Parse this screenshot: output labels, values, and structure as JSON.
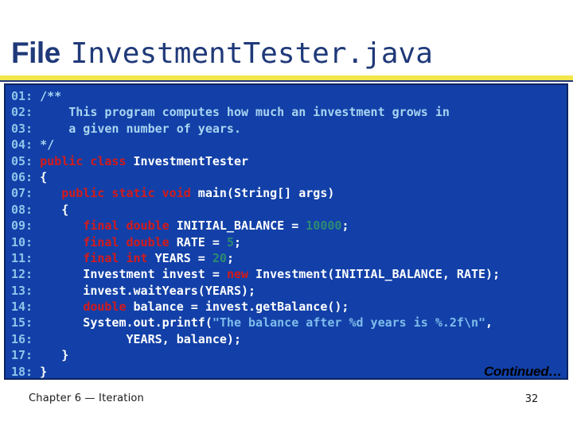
{
  "slide": {
    "title_label": "File",
    "title_filename": "InvestmentTester.java",
    "continued_label": "Continued…",
    "footer_chapter": "Chapter 6 — Iteration",
    "footer_page": "32"
  },
  "colors": {
    "title_navy": "#1F3979",
    "rule_yellow": "#F2E64B",
    "code_background": "#1240A8",
    "code_border": "#0B2461",
    "line_number": "#8FC4EA",
    "comment": "#A8D4F0",
    "keyword": "#D41A1A",
    "identifier": "#FFFFFF",
    "number_literal": "#2E8B74",
    "string_literal": "#7FBDEC"
  },
  "code": {
    "language": "java",
    "lines": [
      {
        "number": "01:",
        "tokens": [
          {
            "t": " ",
            "c": "id"
          },
          {
            "t": "/**",
            "c": "cmt"
          }
        ]
      },
      {
        "number": "02:",
        "tokens": [
          {
            "t": "     This program computes how much an investment grows in",
            "c": "cmt"
          }
        ]
      },
      {
        "number": "03:",
        "tokens": [
          {
            "t": "     a given number of years.",
            "c": "cmt"
          }
        ]
      },
      {
        "number": "04:",
        "tokens": [
          {
            "t": " ",
            "c": "id"
          },
          {
            "t": "*/",
            "c": "cmt"
          }
        ]
      },
      {
        "number": "05:",
        "tokens": [
          {
            "t": " ",
            "c": "id"
          },
          {
            "t": "public class",
            "c": "kw"
          },
          {
            "t": " InvestmentTester",
            "c": "id"
          }
        ]
      },
      {
        "number": "06:",
        "tokens": [
          {
            "t": " {",
            "c": "id"
          }
        ]
      },
      {
        "number": "07:",
        "tokens": [
          {
            "t": "    ",
            "c": "id"
          },
          {
            "t": "public static void",
            "c": "kw"
          },
          {
            "t": " main(String[] args)",
            "c": "id"
          }
        ]
      },
      {
        "number": "08:",
        "tokens": [
          {
            "t": "    {",
            "c": "id"
          }
        ]
      },
      {
        "number": "09:",
        "tokens": [
          {
            "t": "       ",
            "c": "id"
          },
          {
            "t": "final double",
            "c": "kw"
          },
          {
            "t": " INITIAL_BALANCE = ",
            "c": "id"
          },
          {
            "t": "10000",
            "c": "num"
          },
          {
            "t": ";",
            "c": "id"
          }
        ]
      },
      {
        "number": "10:",
        "tokens": [
          {
            "t": "       ",
            "c": "id"
          },
          {
            "t": "final double",
            "c": "kw"
          },
          {
            "t": " RATE = ",
            "c": "id"
          },
          {
            "t": "5",
            "c": "num"
          },
          {
            "t": ";",
            "c": "id"
          }
        ]
      },
      {
        "number": "11:",
        "tokens": [
          {
            "t": "       ",
            "c": "id"
          },
          {
            "t": "final int",
            "c": "kw"
          },
          {
            "t": " YEARS = ",
            "c": "id"
          },
          {
            "t": "20",
            "c": "num"
          },
          {
            "t": ";",
            "c": "id"
          }
        ]
      },
      {
        "number": "12:",
        "tokens": [
          {
            "t": "       Investment invest = ",
            "c": "id"
          },
          {
            "t": "new",
            "c": "kw"
          },
          {
            "t": " Investment(INITIAL_BALANCE, RATE);",
            "c": "id"
          }
        ]
      },
      {
        "number": "13:",
        "tokens": [
          {
            "t": "       invest.waitYears(YEARS);",
            "c": "id"
          }
        ]
      },
      {
        "number": "14:",
        "tokens": [
          {
            "t": "       ",
            "c": "id"
          },
          {
            "t": "double",
            "c": "kw"
          },
          {
            "t": " balance = invest.getBalance();",
            "c": "id"
          }
        ]
      },
      {
        "number": "15:",
        "tokens": [
          {
            "t": "       System.out.printf(",
            "c": "id"
          },
          {
            "t": "\"The balance after %d years is %.2f\\n\"",
            "c": "str"
          },
          {
            "t": ",",
            "c": "id"
          }
        ]
      },
      {
        "number": "16:",
        "tokens": [
          {
            "t": "             YEARS, balance);",
            "c": "id"
          }
        ]
      },
      {
        "number": "17:",
        "tokens": [
          {
            "t": "    }",
            "c": "id"
          }
        ]
      },
      {
        "number": "18:",
        "tokens": [
          {
            "t": " }",
            "c": "id"
          }
        ]
      }
    ]
  }
}
